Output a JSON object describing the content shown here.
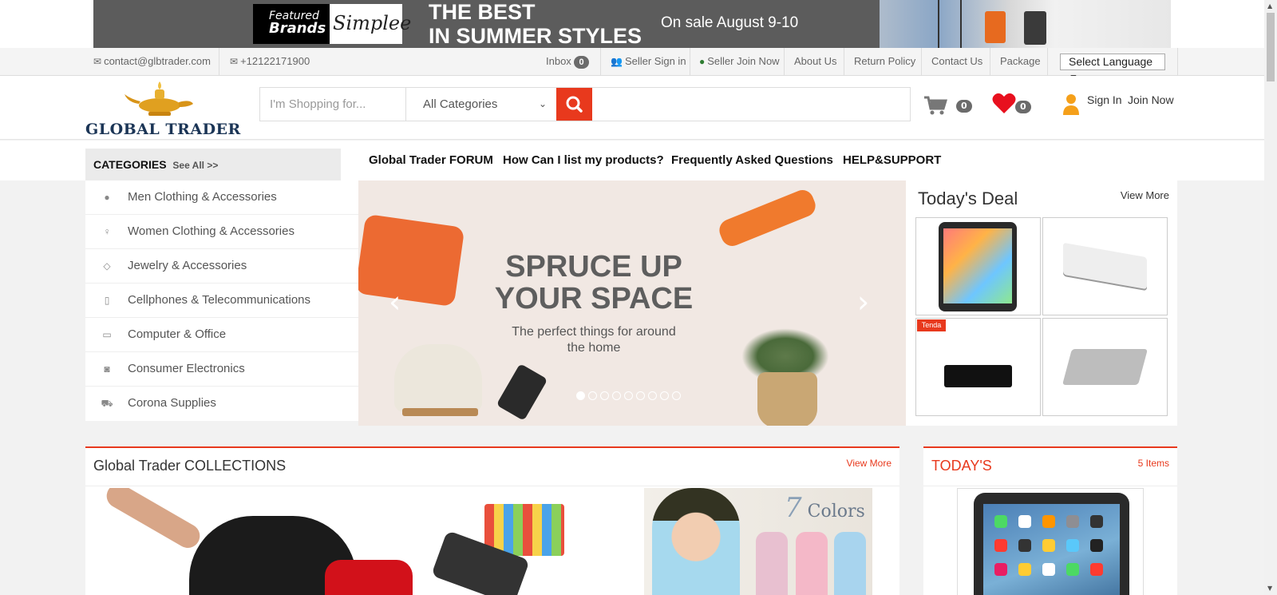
{
  "banner": {
    "featured_line1": "Featured",
    "featured_line2": "Brands",
    "brand_name": "Simplee",
    "headline_line1": "THE BEST",
    "headline_line2": "IN SUMMER STYLES",
    "sale_text": "On sale August 9-10"
  },
  "topbar": {
    "email": "contact@glbtrader.com",
    "phone": "+12122171900",
    "inbox_label": "Inbox",
    "inbox_count": "0",
    "seller_signin": "Seller Sign in",
    "seller_join": "Seller Join Now",
    "about": "About Us",
    "return_policy": "Return Policy",
    "contact": "Contact Us",
    "package": "Package",
    "language": "Select Language",
    "language_arrow": "▼"
  },
  "header": {
    "logo_text": "GLOBAL TRADER",
    "search_placeholder": "I'm Shopping for...",
    "category_selected": "All Categories",
    "cart_count": "0",
    "wishlist_count": "0",
    "sign_in": "Sign In",
    "join_now": "Join Now"
  },
  "nav": {
    "categories_label": "CATEGORIES",
    "see_all": "See All >>",
    "links": [
      "Global Trader FORUM",
      "How Can I list my products?",
      "Frequently Asked Questions",
      "HELP&SUPPORT"
    ]
  },
  "categories": [
    {
      "label": "Men Clothing & Accessories",
      "icon": "person-icon"
    },
    {
      "label": "Women Clothing & Accessories",
      "icon": "female-icon"
    },
    {
      "label": "Jewelry & Accessories",
      "icon": "diamond-icon"
    },
    {
      "label": "Cellphones & Telecommunications",
      "icon": "mobile-icon"
    },
    {
      "label": "Computer & Office",
      "icon": "desktop-icon"
    },
    {
      "label": "Consumer Electronics",
      "icon": "camera-icon"
    },
    {
      "label": "Corona Supplies",
      "icon": "truck-icon"
    }
  ],
  "slider": {
    "headline_line1": "SPRUCE UP",
    "headline_line2": "YOUR SPACE",
    "subtext_line1": "The perfect things for around",
    "subtext_line2": "the home",
    "prev_arrow": "‹",
    "next_arrow": "›",
    "slide_count": 9,
    "active_slide": 1
  },
  "deal": {
    "title": "Today's Deal",
    "view_more": "View More",
    "tenda_label": "Tenda",
    "products": [
      "tablet-product",
      "network-switch-product",
      "router-product",
      "speaker-product"
    ]
  },
  "collections": {
    "title": "Global Trader COLLECTIONS",
    "view_more": "View More",
    "colors_number": "7",
    "colors_word": "Colors"
  },
  "todays": {
    "title": "TODAY'S",
    "count": "5 Items"
  },
  "colors": {
    "accent": "#e8391d",
    "logo_navy": "#1b3556",
    "badge_gray": "#6b6b6b",
    "heart_red": "#e8101e",
    "user_orange": "#f5a01a"
  }
}
